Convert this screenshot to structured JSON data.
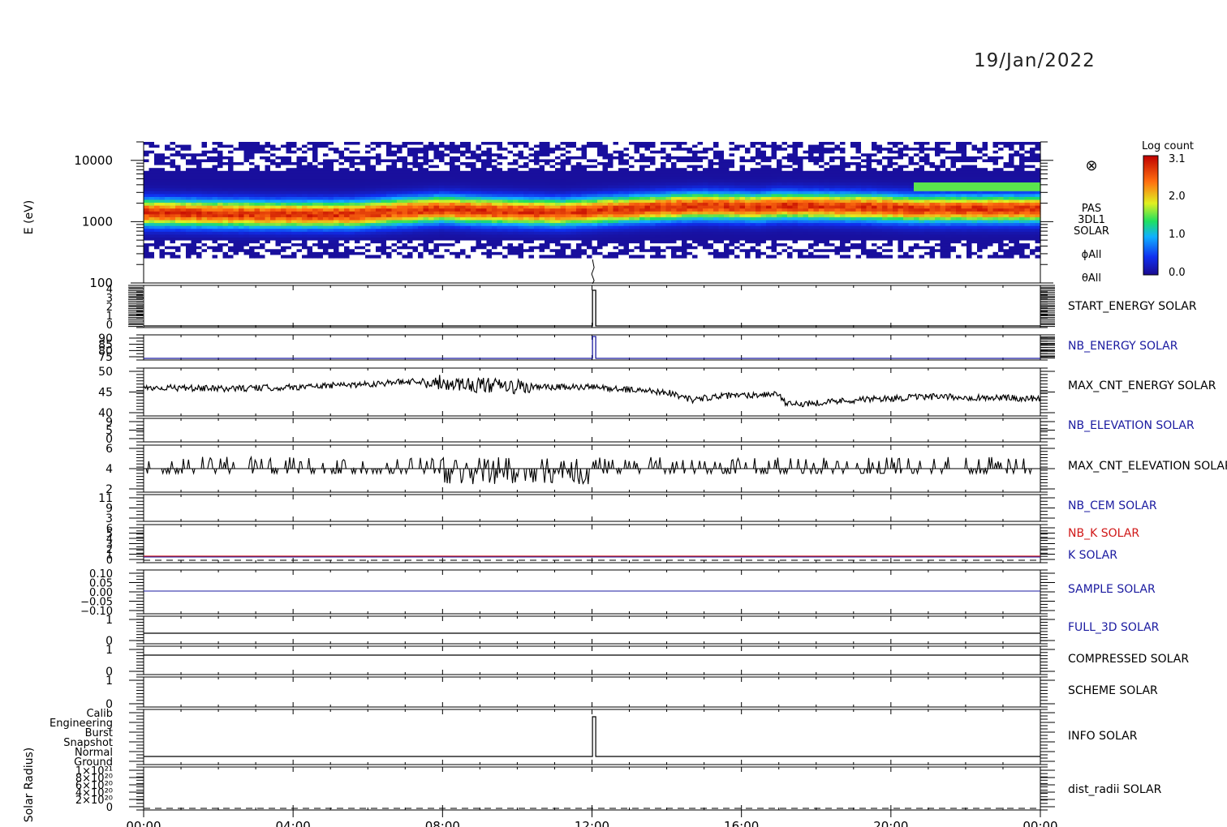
{
  "header": {
    "date": "19/Jan/2022"
  },
  "colorbar": {
    "title": "Log count",
    "ticks": [
      "3.1",
      "2.0",
      "1.0",
      "0.0"
    ],
    "values": [
      3.1,
      2.0,
      1.0,
      0.0
    ]
  },
  "chart_data": {
    "type": "line",
    "x_ticks": [
      "00:00",
      "04:00",
      "08:00",
      "12:00",
      "16:00",
      "20:00",
      "00:00"
    ],
    "x_range_hours": [
      0,
      24
    ],
    "spectrogram": {
      "type": "heatmap",
      "ylabel": "E (eV)",
      "y_scale": "log",
      "ylim": [
        100,
        20000
      ],
      "y_ticks": [
        "10000",
        "1000",
        "100"
      ],
      "labels": [
        "PAS",
        "3DL1",
        "SOLAR",
        "ϕAll",
        "θAll"
      ],
      "peak_energy_track": {
        "hours": [
          0,
          3.4,
          5.5,
          8.0,
          9.0,
          11.2,
          14.9,
          16.5,
          17.0,
          19.5,
          20.6,
          24
        ],
        "energy_ev": [
          1400,
          1300,
          1300,
          1600,
          1500,
          1400,
          1800,
          1700,
          1800,
          1700,
          1600,
          1600
        ]
      }
    },
    "panels": [
      {
        "label": "START_ENERGY SOLAR",
        "label_color": "#000000",
        "ticks": [
          "4",
          "3",
          "2",
          "1",
          "0"
        ],
        "ylim": [
          0,
          4
        ]
      },
      {
        "label": "NB_ENERGY SOLAR",
        "label_color": "#1a1aa0",
        "ticks": [
          "90",
          "85",
          "80",
          "75"
        ],
        "ylim": [
          75,
          90
        ]
      },
      {
        "label": "MAX_CNT_ENERGY SOLAR",
        "label_color": "#000000",
        "ticks": [
          "50",
          "45",
          "40"
        ],
        "ylim": [
          37,
          52
        ],
        "series": {
          "hours": [
            0,
            2,
            4,
            6,
            7.5,
            8.5,
            10,
            12,
            14,
            14.7,
            15.2,
            17.0,
            17.2,
            19,
            21,
            24
          ],
          "values": [
            46,
            45.5,
            46,
            47,
            48,
            47,
            46,
            46,
            44.5,
            42,
            43,
            44,
            40.5,
            42,
            43,
            42.5
          ]
        }
      },
      {
        "label": "NB_ELEVATION SOLAR",
        "label_color": "#1a1aa0",
        "ticks": [
          "9",
          "5",
          "0"
        ],
        "ylim": [
          0,
          9
        ]
      },
      {
        "label": "MAX_CNT_ELEVATION SOLAR",
        "label_color": "#000000",
        "ticks": [
          "6",
          "4",
          "2"
        ],
        "ylim": [
          1,
          7
        ],
        "series": {
          "hours": [
            0,
            24
          ],
          "values": [
            4,
            4
          ]
        }
      },
      {
        "label": "NB_CEM SOLAR",
        "label_color": "#1a1aa0",
        "ticks": [
          "11",
          "9",
          "3"
        ],
        "ylim": [
          3,
          11
        ]
      },
      {
        "label": "NB_K SOLAR",
        "label_color": "#d01818",
        "label2": "K SOLAR",
        "label2_color": "#1a1aa0",
        "ticks": [
          "6",
          "5",
          "4",
          "3",
          "2",
          "1",
          "0"
        ],
        "ylim": [
          0,
          6
        ]
      },
      {
        "label": "SAMPLE SOLAR",
        "label_color": "#1a1aa0",
        "ticks": [
          "0.10",
          "0.05",
          "0.00",
          "−0.05",
          "−0.10"
        ],
        "ylim": [
          -0.1,
          0.1
        ]
      },
      {
        "label": "FULL_3D SOLAR",
        "label_color": "#1a1aa0",
        "ticks": [
          "1",
          "0"
        ],
        "ylim": [
          0,
          1
        ]
      },
      {
        "label": "COMPRESSED SOLAR",
        "label_color": "#000000",
        "ticks": [
          "1",
          "0"
        ],
        "ylim": [
          0,
          1
        ]
      },
      {
        "label": "SCHEME SOLAR",
        "label_color": "#000000",
        "ticks": [
          "1",
          "0"
        ],
        "ylim": [
          0,
          1
        ]
      },
      {
        "label": "INFO SOLAR",
        "label_color": "#000000",
        "ticks": [
          "Calib",
          "Engineering",
          "Burst",
          "Snapshot",
          "Normal",
          "Ground"
        ]
      },
      {
        "label": "dist_radii SOLAR",
        "label_color": "#000000",
        "ylabel": "Solar Radius)",
        "ticks": [
          "1×10²¹",
          "8×10²⁰",
          "6×10²⁰",
          "4×10²⁰",
          "2×10²⁰",
          "0"
        ]
      }
    ]
  }
}
